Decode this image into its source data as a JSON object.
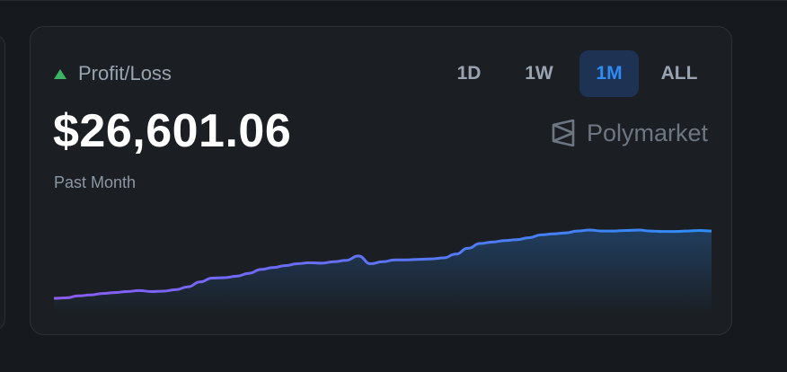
{
  "pnl": {
    "label": "Profit/Loss",
    "trend_icon": "triangle-up-icon",
    "amount": "$26,601.06",
    "period": "Past Month"
  },
  "range_tabs": [
    {
      "label": "1D",
      "active": false
    },
    {
      "label": "1W",
      "active": false
    },
    {
      "label": "1M",
      "active": true
    },
    {
      "label": "ALL",
      "active": false
    }
  ],
  "brand": {
    "name": "Polymarket",
    "icon": "polymarket-logo-icon"
  },
  "colors": {
    "positive": "#3db364",
    "accent": "#2f8cf5",
    "line_start": "#8b5cf6",
    "line_end": "#2f8cf5"
  },
  "chart_data": {
    "type": "area",
    "values": [
      0,
      0.5,
      2.5,
      3.5,
      5,
      6,
      7,
      8,
      7,
      7.5,
      9,
      12,
      17,
      21,
      21.5,
      23,
      26,
      30,
      32,
      34,
      36,
      37,
      36.5,
      38,
      39.5,
      44,
      36,
      38,
      40,
      40,
      40.5,
      41,
      42,
      46,
      52,
      57,
      58.5,
      60,
      61,
      63,
      66,
      67,
      68,
      70,
      71,
      70,
      70,
      70.5,
      71,
      70,
      69.5,
      69.5,
      70,
      70.5,
      70
    ]
  }
}
